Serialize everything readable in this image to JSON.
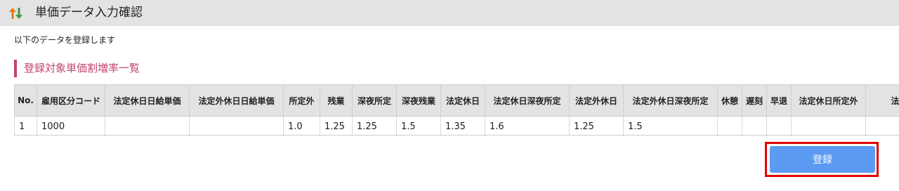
{
  "header": {
    "title": "単価データ入力確認",
    "icon": "sort-arrows-icon",
    "icon_colors": {
      "up": "#e07a1c",
      "down": "#3e9a3e"
    }
  },
  "intro_text": "以下のデータを登録します",
  "section": {
    "title": "登録対象単価割増率一覧",
    "accent_color": "#c2456e"
  },
  "table": {
    "columns": [
      "No.",
      "雇用区分コード",
      "法定休日日給単価",
      "法定外休日日給単価",
      "所定外",
      "残業",
      "深夜所定",
      "深夜残業",
      "法定休日",
      "法定休日深夜所定",
      "法定外休日",
      "法定外休日深夜所定",
      "休憩",
      "遅刻",
      "早退",
      "法定休日所定外",
      "法定休"
    ],
    "rows": [
      [
        "1",
        "1000",
        "",
        "",
        "1.0",
        "1.25",
        "1.25",
        "1.5",
        "1.35",
        "1.6",
        "1.25",
        "1.5",
        "",
        "",
        "",
        "",
        ""
      ]
    ]
  },
  "actions": {
    "register_label": "登録",
    "register_color": "#5b9bf2",
    "highlight_color": "#e00000"
  }
}
